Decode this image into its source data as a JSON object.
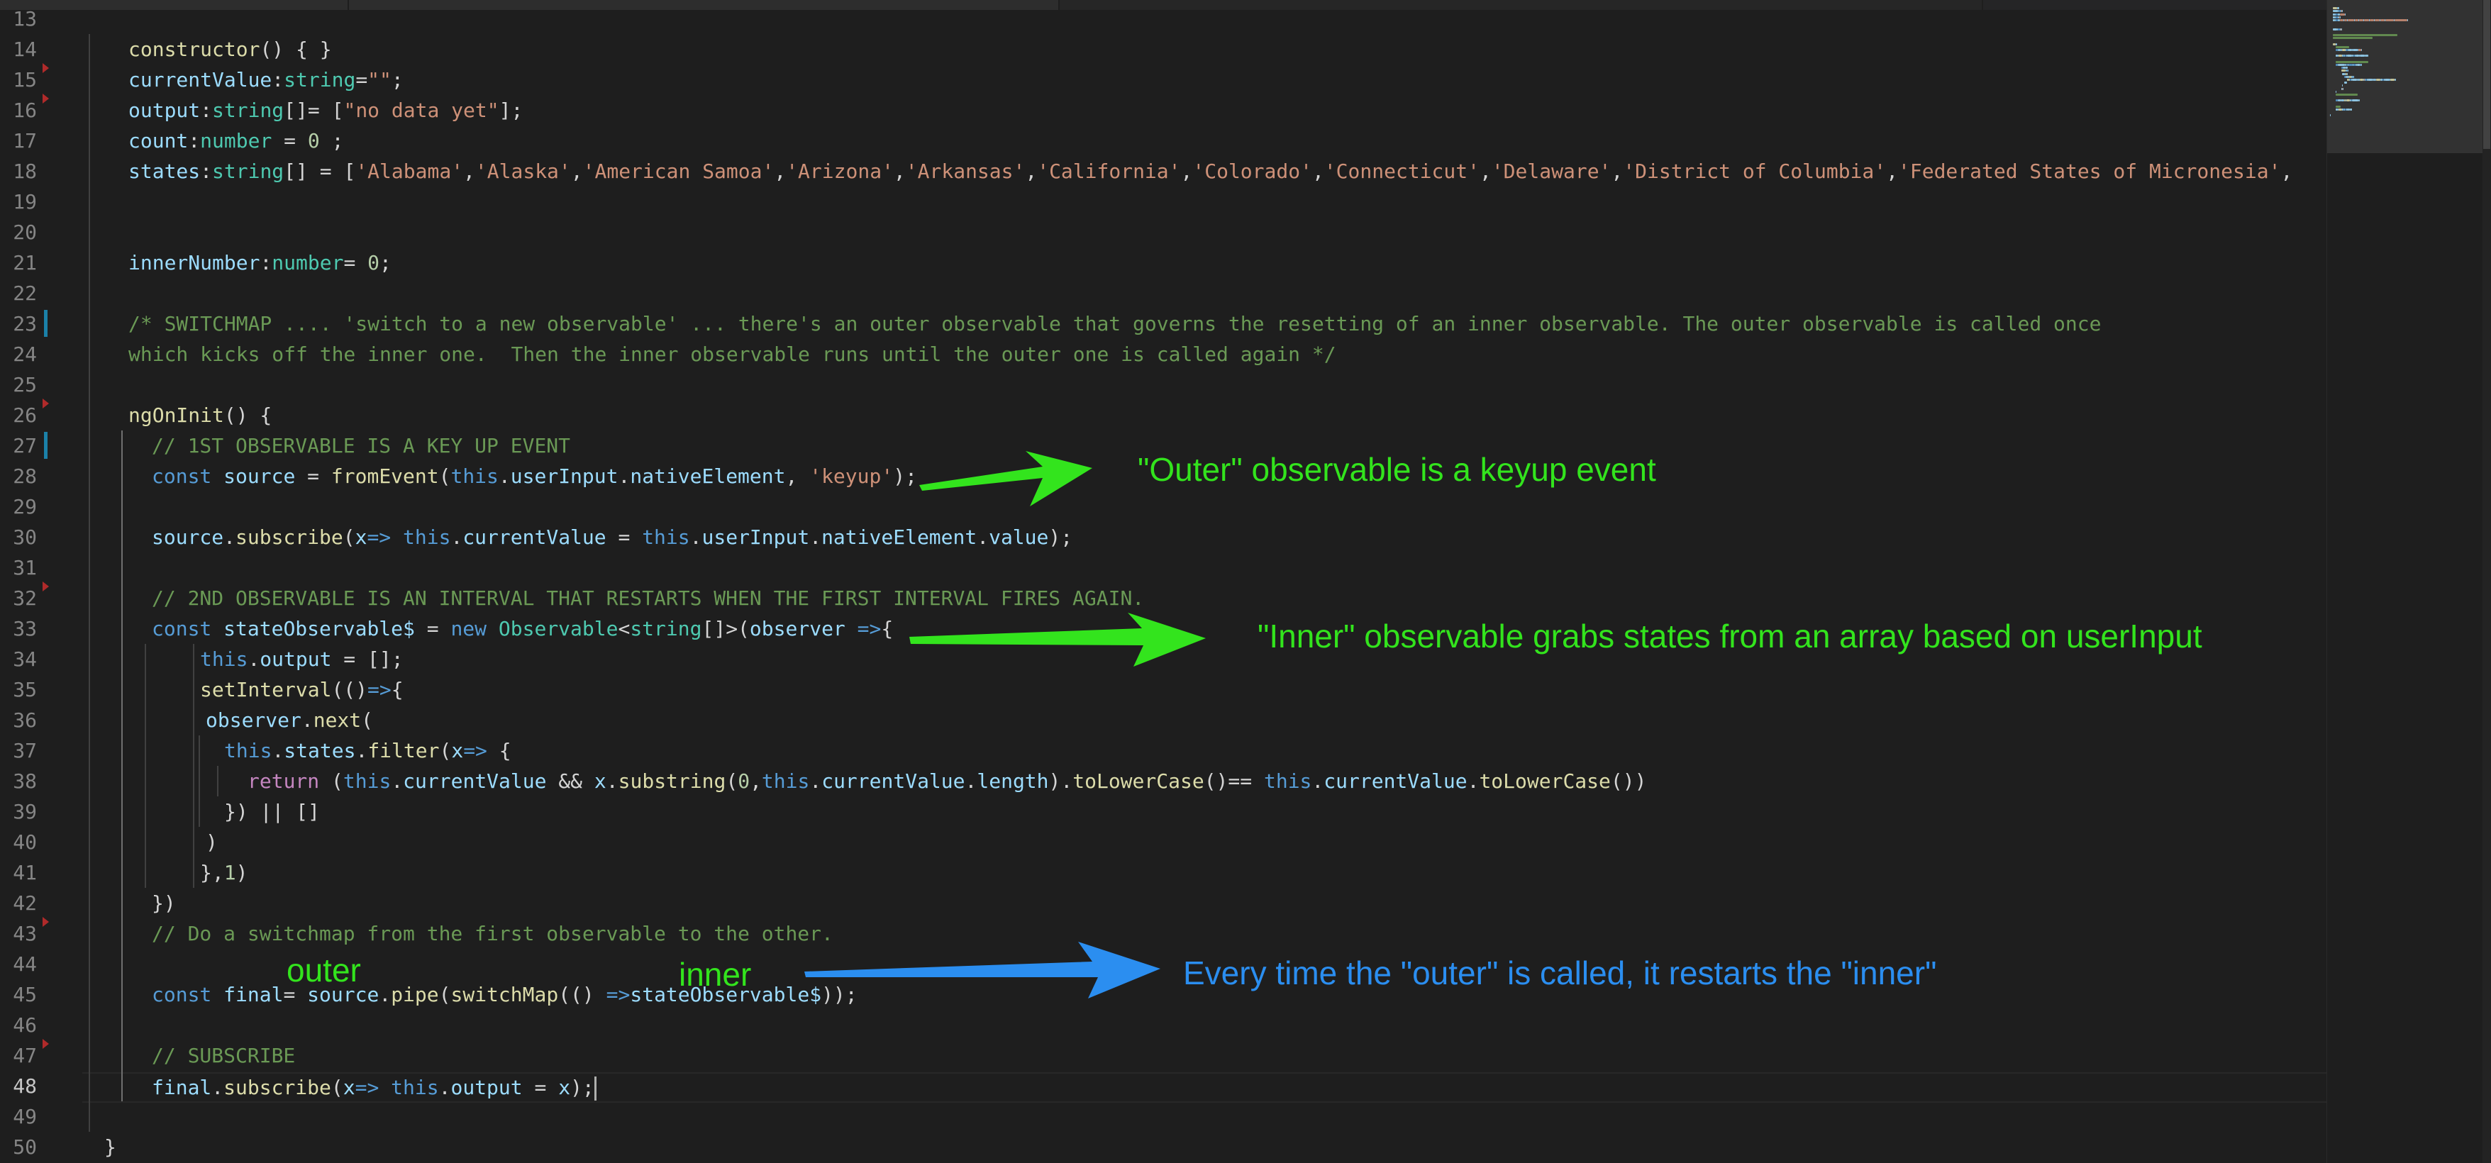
{
  "editor": {
    "active_line": "48",
    "colors": {
      "background": "#1e1e1e",
      "keyword": "#569cd6",
      "function": "#dcdcaa",
      "property": "#9cdcfe",
      "type": "#4ec9b0",
      "string": "#ce9178",
      "number": "#b5cea8",
      "comment": "#6a9955",
      "control": "#c586c0",
      "line_number": "#858585"
    },
    "gutter_markers": [
      {
        "line": "15",
        "kind": "deleted"
      },
      {
        "line": "16",
        "kind": "deleted"
      },
      {
        "line": "23",
        "kind": "modified"
      },
      {
        "line": "26",
        "kind": "deleted"
      },
      {
        "line": "27",
        "kind": "modified"
      },
      {
        "line": "32",
        "kind": "deleted"
      },
      {
        "line": "43",
        "kind": "deleted"
      },
      {
        "line": "47",
        "kind": "deleted"
      }
    ],
    "lines": [
      {
        "n": "13",
        "indent": 0,
        "tokens": []
      },
      {
        "n": "14",
        "indent": 1,
        "tokens": [
          [
            "fn",
            "constructor"
          ],
          [
            "pn",
            "() { }"
          ]
        ]
      },
      {
        "n": "15",
        "indent": 1,
        "tokens": [
          [
            "pr",
            "currentValue"
          ],
          [
            "pn",
            ":"
          ],
          [
            "ty",
            "string"
          ],
          [
            "pn",
            "="
          ],
          [
            "st",
            "\"\""
          ],
          [
            "pn",
            ";"
          ]
        ]
      },
      {
        "n": "16",
        "indent": 1,
        "tokens": [
          [
            "pr",
            "output"
          ],
          [
            "pn",
            ":"
          ],
          [
            "ty",
            "string"
          ],
          [
            "pn",
            "[]= ["
          ],
          [
            "st",
            "\"no data yet\""
          ],
          [
            "pn",
            "];"
          ]
        ]
      },
      {
        "n": "17",
        "indent": 1,
        "tokens": [
          [
            "pr",
            "count"
          ],
          [
            "pn",
            ":"
          ],
          [
            "ty",
            "number"
          ],
          [
            "pn",
            " = "
          ],
          [
            "nu",
            "0"
          ],
          [
            "pn",
            " ;"
          ]
        ]
      },
      {
        "n": "18",
        "indent": 1,
        "tokens": [
          [
            "pr",
            "states"
          ],
          [
            "pn",
            ":"
          ],
          [
            "ty",
            "string"
          ],
          [
            "pn",
            "[] = ["
          ],
          [
            "st",
            "'Alabama'"
          ],
          [
            "pn",
            ","
          ],
          [
            "st",
            "'Alaska'"
          ],
          [
            "pn",
            ","
          ],
          [
            "st",
            "'American Samoa'"
          ],
          [
            "pn",
            ","
          ],
          [
            "st",
            "'Arizona'"
          ],
          [
            "pn",
            ","
          ],
          [
            "st",
            "'Arkansas'"
          ],
          [
            "pn",
            ","
          ],
          [
            "st",
            "'California'"
          ],
          [
            "pn",
            ","
          ],
          [
            "st",
            "'Colorado'"
          ],
          [
            "pn",
            ","
          ],
          [
            "st",
            "'Connecticut'"
          ],
          [
            "pn",
            ","
          ],
          [
            "st",
            "'Delaware'"
          ],
          [
            "pn",
            ","
          ],
          [
            "st",
            "'District of Columbia'"
          ],
          [
            "pn",
            ","
          ],
          [
            "st",
            "'Federated States of Micronesia'"
          ],
          [
            "pn",
            ","
          ]
        ]
      },
      {
        "n": "19",
        "indent": 0,
        "tokens": []
      },
      {
        "n": "20",
        "indent": 0,
        "tokens": []
      },
      {
        "n": "21",
        "indent": 1,
        "tokens": [
          [
            "pr",
            "innerNumber"
          ],
          [
            "pn",
            ":"
          ],
          [
            "ty",
            "number"
          ],
          [
            "pn",
            "= "
          ],
          [
            "nu",
            "0"
          ],
          [
            "pn",
            ";"
          ]
        ]
      },
      {
        "n": "22",
        "indent": 0,
        "tokens": []
      },
      {
        "n": "23",
        "indent": 1,
        "tokens": [
          [
            "cm",
            "/* SWITCHMAP .... 'switch to a new observable' ... there's an outer observable that governs the resetting of an inner observable. The outer observable is called once"
          ]
        ]
      },
      {
        "n": "24",
        "indent": 1,
        "tokens": [
          [
            "cm",
            "which kicks off the inner one.  Then the inner observable runs until the outer one is called again */"
          ]
        ]
      },
      {
        "n": "25",
        "indent": 0,
        "tokens": []
      },
      {
        "n": "26",
        "indent": 1,
        "tokens": [
          [
            "fn",
            "ngOnInit"
          ],
          [
            "pn",
            "() {"
          ]
        ]
      },
      {
        "n": "27",
        "indent": 2,
        "tokens": [
          [
            "cm",
            "// 1ST OBSERVABLE IS A KEY UP EVENT"
          ]
        ]
      },
      {
        "n": "28",
        "indent": 2,
        "tokens": [
          [
            "kw",
            "const"
          ],
          [
            "pn",
            " "
          ],
          [
            "pr",
            "source"
          ],
          [
            "pn",
            " = "
          ],
          [
            "fn",
            "fromEvent"
          ],
          [
            "pn",
            "("
          ],
          [
            "kw",
            "this"
          ],
          [
            "pn",
            "."
          ],
          [
            "pr",
            "userInput"
          ],
          [
            "pn",
            "."
          ],
          [
            "pr",
            "nativeElement"
          ],
          [
            "pn",
            ", "
          ],
          [
            "st",
            "'keyup'"
          ],
          [
            "pn",
            ");"
          ]
        ]
      },
      {
        "n": "29",
        "indent": 0,
        "tokens": []
      },
      {
        "n": "30",
        "indent": 2,
        "tokens": [
          [
            "pr",
            "source"
          ],
          [
            "pn",
            "."
          ],
          [
            "fn",
            "subscribe"
          ],
          [
            "pn",
            "("
          ],
          [
            "pr",
            "x"
          ],
          [
            "kw",
            "=>"
          ],
          [
            "pn",
            " "
          ],
          [
            "kw",
            "this"
          ],
          [
            "pn",
            "."
          ],
          [
            "pr",
            "currentValue"
          ],
          [
            "pn",
            " = "
          ],
          [
            "kw",
            "this"
          ],
          [
            "pn",
            "."
          ],
          [
            "pr",
            "userInput"
          ],
          [
            "pn",
            "."
          ],
          [
            "pr",
            "nativeElement"
          ],
          [
            "pn",
            "."
          ],
          [
            "pr",
            "value"
          ],
          [
            "pn",
            ");"
          ]
        ]
      },
      {
        "n": "31",
        "indent": 0,
        "tokens": []
      },
      {
        "n": "32",
        "indent": 2,
        "tokens": [
          [
            "cm",
            "// 2ND OBSERVABLE IS AN INTERVAL THAT RESTARTS WHEN THE FIRST INTERVAL FIRES AGAIN."
          ]
        ]
      },
      {
        "n": "33",
        "indent": 2,
        "tokens": [
          [
            "kw",
            "const"
          ],
          [
            "pn",
            " "
          ],
          [
            "pr",
            "stateObservable$"
          ],
          [
            "pn",
            " = "
          ],
          [
            "kw",
            "new"
          ],
          [
            "pn",
            " "
          ],
          [
            "ty",
            "Observable"
          ],
          [
            "pn",
            "<"
          ],
          [
            "ty",
            "string"
          ],
          [
            "pn",
            "[]>("
          ],
          [
            "pr",
            "observer"
          ],
          [
            "pn",
            " "
          ],
          [
            "kw",
            "=>"
          ],
          [
            "pn",
            "{"
          ]
        ]
      },
      {
        "n": "34",
        "indent": 4,
        "tokens": [
          [
            "kw",
            "this"
          ],
          [
            "pn",
            "."
          ],
          [
            "pr",
            "output"
          ],
          [
            "pn",
            " = [];"
          ]
        ]
      },
      {
        "n": "35",
        "indent": 4,
        "tokens": [
          [
            "fn",
            "setInterval"
          ],
          [
            "pn",
            "(()"
          ],
          [
            "kw",
            "=>"
          ],
          [
            "pn",
            "{"
          ]
        ]
      },
      {
        "n": "36",
        "indent": 4.25,
        "tokens": [
          [
            "pr",
            "observer"
          ],
          [
            "pn",
            "."
          ],
          [
            "fn",
            "next"
          ],
          [
            "pn",
            "("
          ]
        ]
      },
      {
        "n": "37",
        "indent": 5,
        "tokens": [
          [
            "kw",
            "this"
          ],
          [
            "pn",
            "."
          ],
          [
            "pr",
            "states"
          ],
          [
            "pn",
            "."
          ],
          [
            "fn",
            "filter"
          ],
          [
            "pn",
            "("
          ],
          [
            "pr",
            "x"
          ],
          [
            "kw",
            "=>"
          ],
          [
            "pn",
            " {"
          ]
        ]
      },
      {
        "n": "38",
        "indent": 6,
        "tokens": [
          [
            "cf",
            "return"
          ],
          [
            "pn",
            " ("
          ],
          [
            "kw",
            "this"
          ],
          [
            "pn",
            "."
          ],
          [
            "pr",
            "currentValue"
          ],
          [
            "pn",
            " && "
          ],
          [
            "pr",
            "x"
          ],
          [
            "pn",
            "."
          ],
          [
            "fn",
            "substring"
          ],
          [
            "pn",
            "("
          ],
          [
            "nu",
            "0"
          ],
          [
            "pn",
            ","
          ],
          [
            "kw",
            "this"
          ],
          [
            "pn",
            "."
          ],
          [
            "pr",
            "currentValue"
          ],
          [
            "pn",
            "."
          ],
          [
            "pr",
            "length"
          ],
          [
            "pn",
            ")."
          ],
          [
            "fn",
            "toLowerCase"
          ],
          [
            "pn",
            "()== "
          ],
          [
            "kw",
            "this"
          ],
          [
            "pn",
            "."
          ],
          [
            "pr",
            "currentValue"
          ],
          [
            "pn",
            "."
          ],
          [
            "fn",
            "toLowerCase"
          ],
          [
            "pn",
            "())"
          ]
        ]
      },
      {
        "n": "39",
        "indent": 5,
        "tokens": [
          [
            "pn",
            "}) || []"
          ]
        ]
      },
      {
        "n": "40",
        "indent": 4.25,
        "tokens": [
          [
            "pn",
            ")"
          ]
        ]
      },
      {
        "n": "41",
        "indent": 4,
        "tokens": [
          [
            "pn",
            "},"
          ],
          [
            "nu",
            "1"
          ],
          [
            "pn",
            ")"
          ]
        ]
      },
      {
        "n": "42",
        "indent": 2,
        "tokens": [
          [
            "pn",
            "})"
          ]
        ]
      },
      {
        "n": "43",
        "indent": 2,
        "tokens": [
          [
            "cm",
            "// Do a switchmap from the first observable to the other."
          ]
        ]
      },
      {
        "n": "44",
        "indent": 0,
        "tokens": []
      },
      {
        "n": "45",
        "indent": 2,
        "tokens": [
          [
            "kw",
            "const"
          ],
          [
            "pn",
            " "
          ],
          [
            "pr",
            "final"
          ],
          [
            "pn",
            "= "
          ],
          [
            "pr",
            "source"
          ],
          [
            "pn",
            "."
          ],
          [
            "fn",
            "pipe"
          ],
          [
            "pn",
            "("
          ],
          [
            "fn",
            "switchMap"
          ],
          [
            "pn",
            "(() "
          ],
          [
            "kw",
            "=>"
          ],
          [
            "pr",
            "stateObservable$"
          ],
          [
            "pn",
            "));"
          ]
        ]
      },
      {
        "n": "46",
        "indent": 0,
        "tokens": []
      },
      {
        "n": "47",
        "indent": 2,
        "tokens": [
          [
            "cm",
            "// SUBSCRIBE"
          ]
        ]
      },
      {
        "n": "48",
        "indent": 2,
        "tokens": [
          [
            "pr",
            "final"
          ],
          [
            "pn",
            "."
          ],
          [
            "fn",
            "subscribe"
          ],
          [
            "pn",
            "("
          ],
          [
            "pr",
            "x"
          ],
          [
            "kw",
            "=>"
          ],
          [
            "pn",
            " "
          ],
          [
            "kw",
            "this"
          ],
          [
            "pn",
            "."
          ],
          [
            "pr",
            "output"
          ],
          [
            "pn",
            " = "
          ],
          [
            "pr",
            "x"
          ],
          [
            "pn",
            ");"
          ]
        ],
        "cursor": true
      },
      {
        "n": "49",
        "indent": 0,
        "tokens": []
      },
      {
        "n": "50",
        "indent": 0,
        "tokens": [
          [
            "pn",
            "}"
          ]
        ]
      }
    ]
  },
  "annotations": {
    "outer_keyup": "\"Outer\" observable is a keyup event",
    "inner_grabs": "\"Inner\" observable grabs states from an array based on userInput",
    "label_outer": "outer",
    "label_inner": "inner",
    "restart_note": "Every time the \"outer\" is called, it restarts the \"inner\"",
    "colors": {
      "green": "#33e41d",
      "blue": "#2b8ef0"
    }
  }
}
